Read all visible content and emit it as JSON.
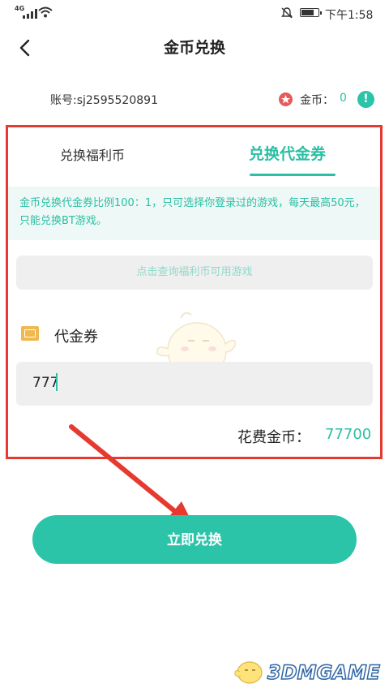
{
  "status_bar": {
    "network": "4G",
    "time": "下午1:58"
  },
  "header": {
    "title": "金币兑换"
  },
  "account": {
    "label": "账号:sj2595520891",
    "coin_label": "金币：",
    "coin_value": "0",
    "info_glyph": "!"
  },
  "tabs": [
    {
      "label": "兑换福利币",
      "active": false
    },
    {
      "label": "兑换代金券",
      "active": true
    }
  ],
  "notice": "金币兑换代金券比例100：1，只可选择你登录过的游戏，每天最高50元，只能兑换BT游戏。",
  "query_button": "点击查询福利币可用游戏",
  "voucher": {
    "label": "代金券"
  },
  "amount_input": {
    "value": "777"
  },
  "cost": {
    "label": "花费金币：",
    "value": "77700"
  },
  "submit_button": "立即兑换",
  "watermark": "3DMGAME",
  "colors": {
    "accent": "#2bbfa4",
    "highlight_frame": "#e6392f",
    "arrow": "#e6392f"
  }
}
